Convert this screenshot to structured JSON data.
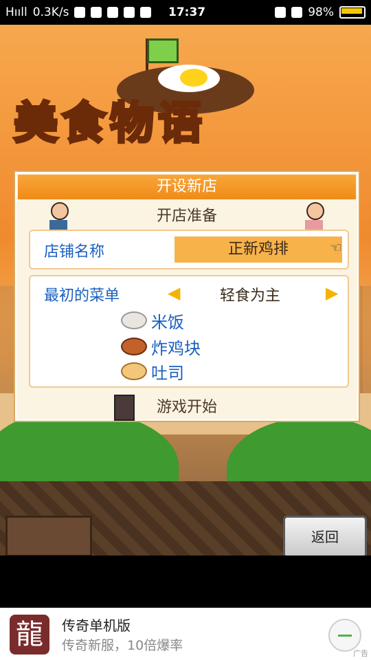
{
  "status": {
    "signal": "Hııll",
    "speed": "0.3K/s",
    "time": "17:37",
    "battery": "98%"
  },
  "dialog": {
    "title": "开设新店",
    "subtitle": "开店准备",
    "name_label": "店铺名称",
    "name_value": "正新鸡排",
    "menu_label": "最初的菜单",
    "menu_style": "轻食为主",
    "items": [
      "米饭",
      "炸鸡块",
      "吐司"
    ],
    "start": "游戏开始"
  },
  "buttons": {
    "back": "返回"
  },
  "ad": {
    "title": "传奇单机版",
    "subtitle": "传奇新服，10倍爆率",
    "logo_char": "龍",
    "tag": "广告"
  }
}
